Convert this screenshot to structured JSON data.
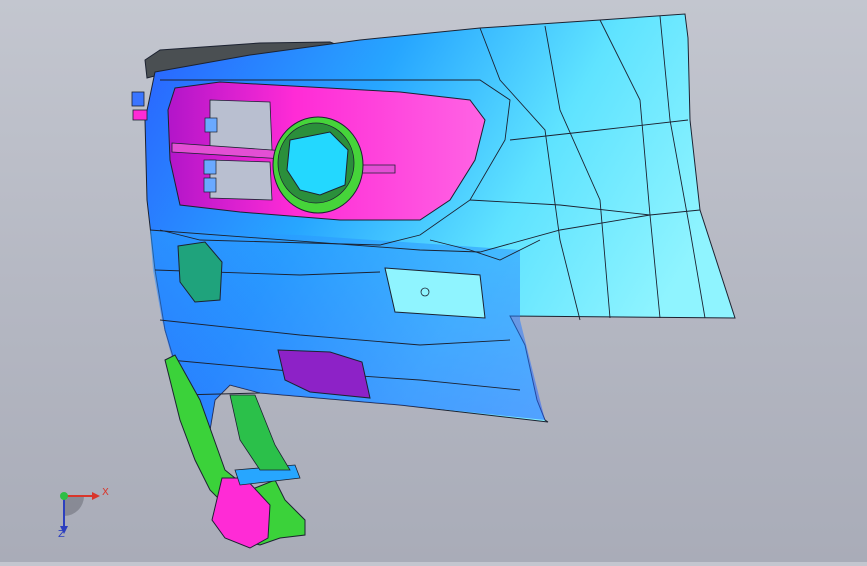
{
  "viewport": {
    "background_top": "#c3c6cf",
    "background_bottom": "#a9acb8",
    "model": {
      "part": "front-bumper-corner",
      "colors": {
        "body_light": "#8ff4ff",
        "body_mid": "#27c3ff",
        "body_dark": "#2a5eff",
        "grille": "#ff2bd6",
        "fog_lamp_lens": "#23d8ff",
        "fog_lamp_ring": "#46d43a",
        "bracket": "#3bd23a",
        "reflector_left": "#1fa37c",
        "reflector_lower": "#8d22c7",
        "top_lip": "#4a4f52",
        "edge_line": "#1c2231"
      }
    }
  },
  "triad": {
    "x_label": "X",
    "z_label": "Z",
    "colors": {
      "x": "#d9362b",
      "y": "#2dbf45",
      "z": "#2c3fbf"
    }
  }
}
